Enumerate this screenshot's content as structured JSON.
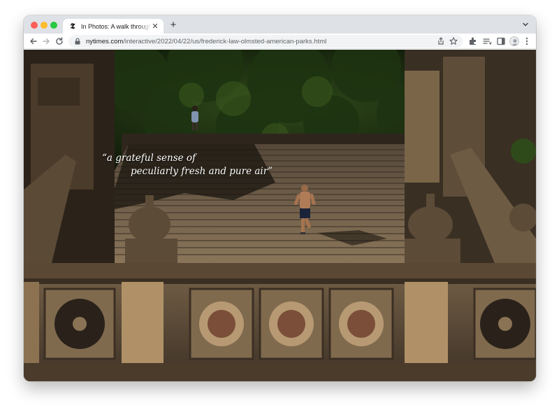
{
  "browser": {
    "tab": {
      "title": "In Photos: A walk through Frederick Law Olmsted's American Parks",
      "favicon": "nyt-logo-icon"
    },
    "address": {
      "host": "nytimes.com",
      "path": "/interactive/2022/04/22/us/frederick-law-olmsted-american-parks.html"
    },
    "icons": [
      "back-icon",
      "forward-icon",
      "reload-icon",
      "lock-icon",
      "share-icon",
      "bookmark-star-icon",
      "extensions-icon",
      "reading-list-icon",
      "side-panel-icon",
      "profile-avatar",
      "more-menu-icon",
      "tab-search-icon",
      "new-tab-icon",
      "tab-close-icon"
    ]
  },
  "page": {
    "quote_line1": "“a grateful sense of",
    "quote_line2": "peculiarly fresh and pure air”"
  },
  "colors": {
    "close": "#fe5f57",
    "minimize": "#febc2e",
    "maximize": "#28c840",
    "tabstrip": "#dee1e6"
  }
}
